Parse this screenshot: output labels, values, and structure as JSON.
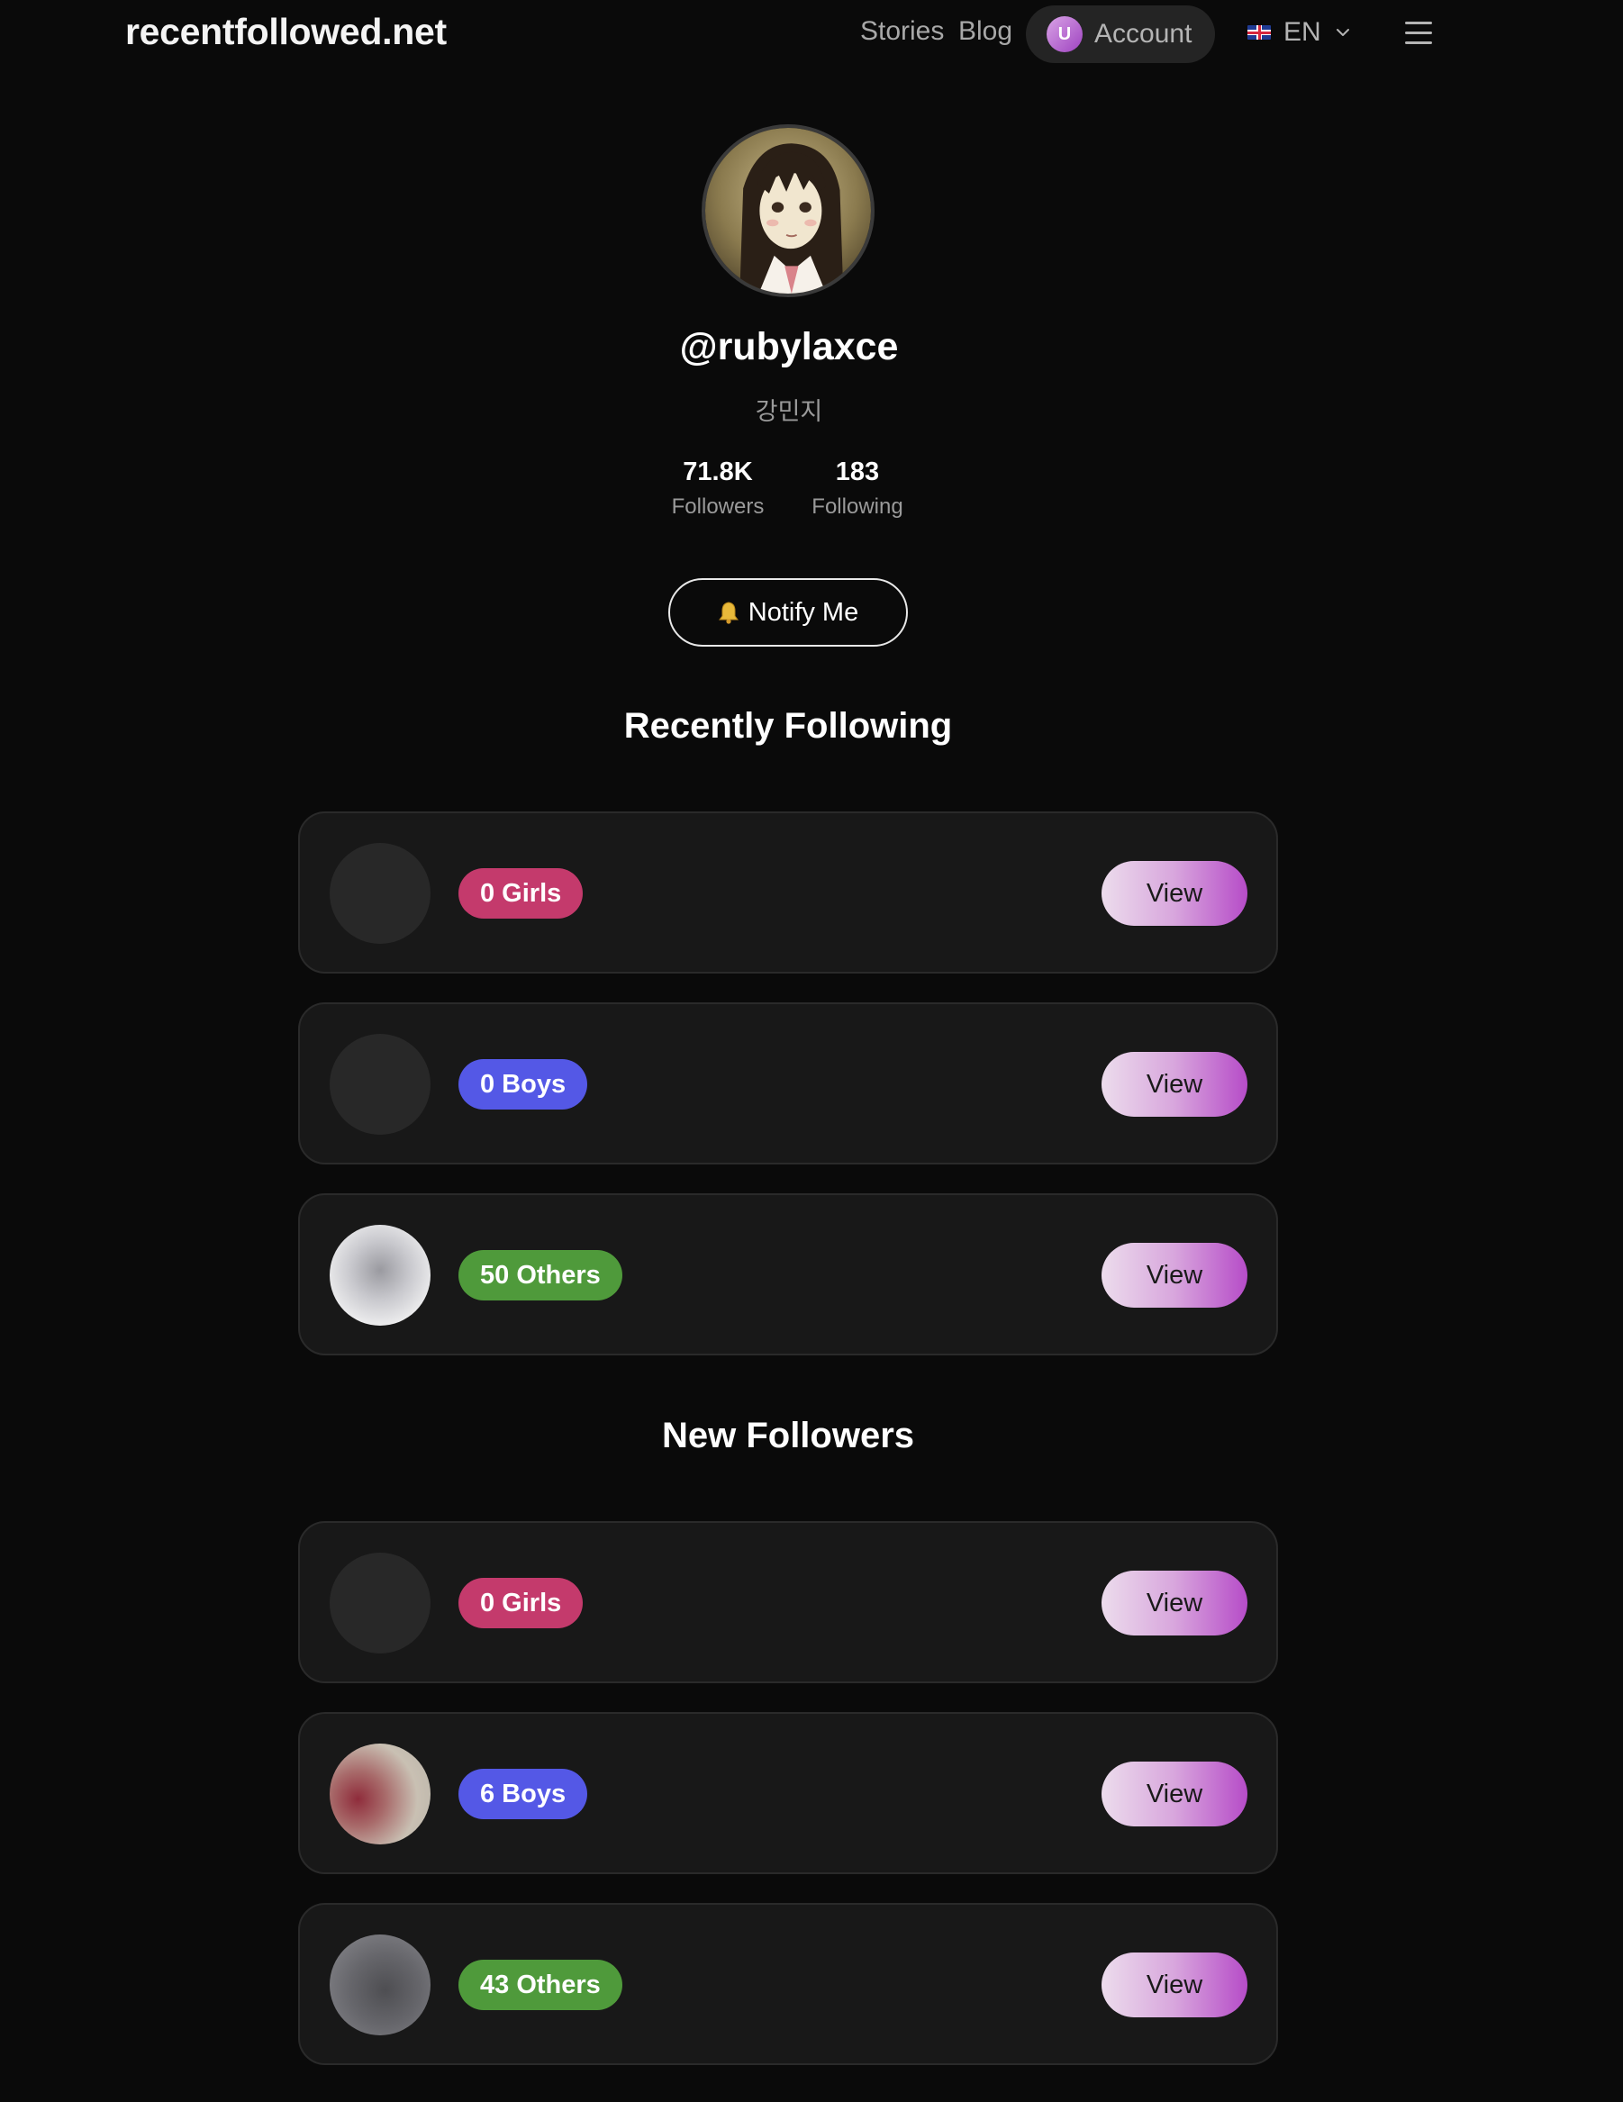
{
  "header": {
    "brand": "recentfollowed.net",
    "nav": {
      "stories": "Stories",
      "blog": "Blog"
    },
    "account": {
      "initial": "U",
      "label": "Account"
    },
    "language": {
      "code": "EN",
      "flag": "uk-flag-icon"
    },
    "menu_icon": "hamburger-menu-icon"
  },
  "profile": {
    "username": "@rubylaxce",
    "display_name": "강민지",
    "stats": {
      "followers": {
        "value": "71.8K",
        "label": "Followers"
      },
      "following": {
        "value": "183",
        "label": "Following"
      }
    },
    "notify_button": "Notify Me"
  },
  "sections": {
    "recently_following": {
      "title": "Recently Following",
      "cards": [
        {
          "badge": "0 Girls",
          "button": "View"
        },
        {
          "badge": "0 Boys",
          "button": "View"
        },
        {
          "badge": "50 Others",
          "button": "View"
        }
      ]
    },
    "new_followers": {
      "title": "New Followers",
      "cards": [
        {
          "badge": "0 Girls",
          "button": "View"
        },
        {
          "badge": "6 Boys",
          "button": "View"
        },
        {
          "badge": "43 Others",
          "button": "View"
        }
      ]
    }
  },
  "colors": {
    "background": "#0a0a0a",
    "card": "#181818",
    "girls_badge": "#c43a6c",
    "boys_badge": "#5458e6",
    "others_badge": "#4f9a3b",
    "view_gradient_end": "#b64cc8"
  }
}
